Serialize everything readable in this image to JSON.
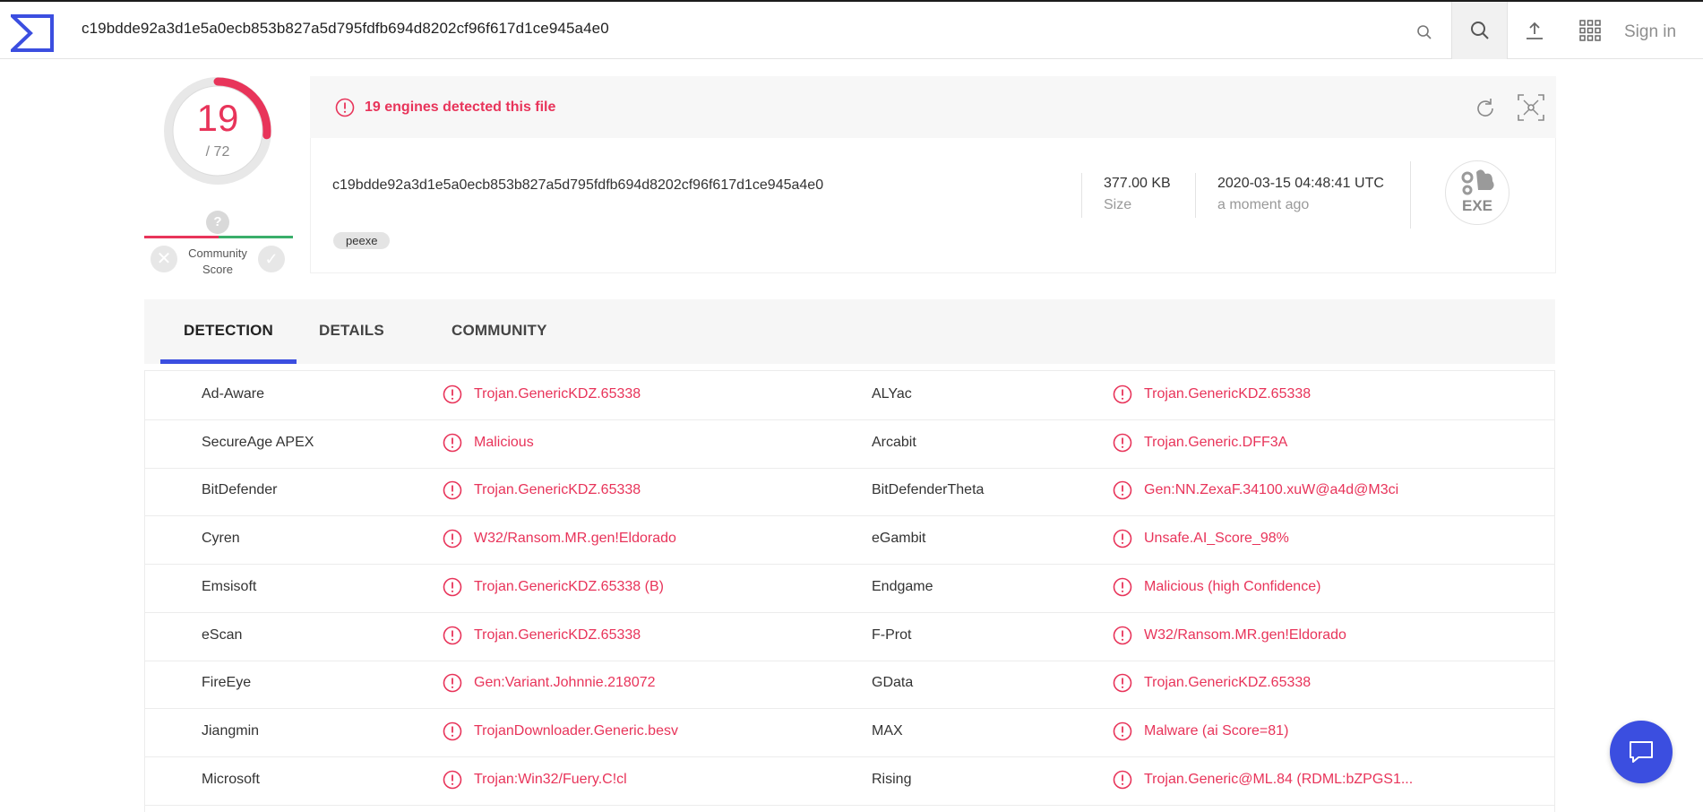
{
  "search": {
    "value": "c19bdde92a3d1e5a0ecb853b827a5d795fdfb694d8202cf96f617d1ce945a4e0"
  },
  "header": {
    "signin_label": "Sign in"
  },
  "score": {
    "detected": "19",
    "total": "/ 72",
    "detected_count": 19,
    "total_count": 72
  },
  "community": {
    "question": "?",
    "label_line1": "Community",
    "label_line2": "Score"
  },
  "banner": {
    "text": "19 engines detected this file"
  },
  "file": {
    "hash": "c19bdde92a3d1e5a0ecb853b827a5d795fdfb694d8202cf96f617d1ce945a4e0",
    "tag": "peexe",
    "size_value": "377.00 KB",
    "size_label": "Size",
    "date_value": "2020-03-15 04:48:41 UTC",
    "date_label": "a moment ago",
    "type_label": "EXE"
  },
  "tabs": [
    {
      "label": "DETECTION",
      "active": true
    },
    {
      "label": "DETAILS",
      "active": false
    },
    {
      "label": "COMMUNITY",
      "active": false
    }
  ],
  "detections": [
    {
      "engine1": "Ad-Aware",
      "result1": "Trojan.GenericKDZ.65338",
      "engine2": "ALYac",
      "result2": "Trojan.GenericKDZ.65338"
    },
    {
      "engine1": "SecureAge APEX",
      "result1": "Malicious",
      "engine2": "Arcabit",
      "result2": "Trojan.Generic.DFF3A"
    },
    {
      "engine1": "BitDefender",
      "result1": "Trojan.GenericKDZ.65338",
      "engine2": "BitDefenderTheta",
      "result2": "Gen:NN.ZexaF.34100.xuW@a4d@M3ci"
    },
    {
      "engine1": "Cyren",
      "result1": "W32/Ransom.MR.gen!Eldorado",
      "engine2": "eGambit",
      "result2": "Unsafe.AI_Score_98%"
    },
    {
      "engine1": "Emsisoft",
      "result1": "Trojan.GenericKDZ.65338 (B)",
      "engine2": "Endgame",
      "result2": "Malicious (high Confidence)"
    },
    {
      "engine1": "eScan",
      "result1": "Trojan.GenericKDZ.65338",
      "engine2": "F-Prot",
      "result2": "W32/Ransom.MR.gen!Eldorado"
    },
    {
      "engine1": "FireEye",
      "result1": "Gen:Variant.Johnnie.218072",
      "engine2": "GData",
      "result2": "Trojan.GenericKDZ.65338"
    },
    {
      "engine1": "Jiangmin",
      "result1": "TrojanDownloader.Generic.besv",
      "engine2": "MAX",
      "result2": "Malware (ai Score=81)"
    },
    {
      "engine1": "Microsoft",
      "result1": "Trojan:Win32/Fuery.C!cl",
      "engine2": "Rising",
      "result2": "Trojan.Generic@ML.84 (RDML:bZPGS1..."
    }
  ],
  "colors": {
    "accent": "#3b4ee0",
    "malicious": "#e8345a",
    "good": "#3aae6a"
  },
  "icons": [
    "logo-icon",
    "search-icon",
    "upload-icon",
    "apps-grid-icon",
    "alert-icon",
    "refresh-icon",
    "graph-icon",
    "exe-file-icon",
    "chat-icon"
  ]
}
